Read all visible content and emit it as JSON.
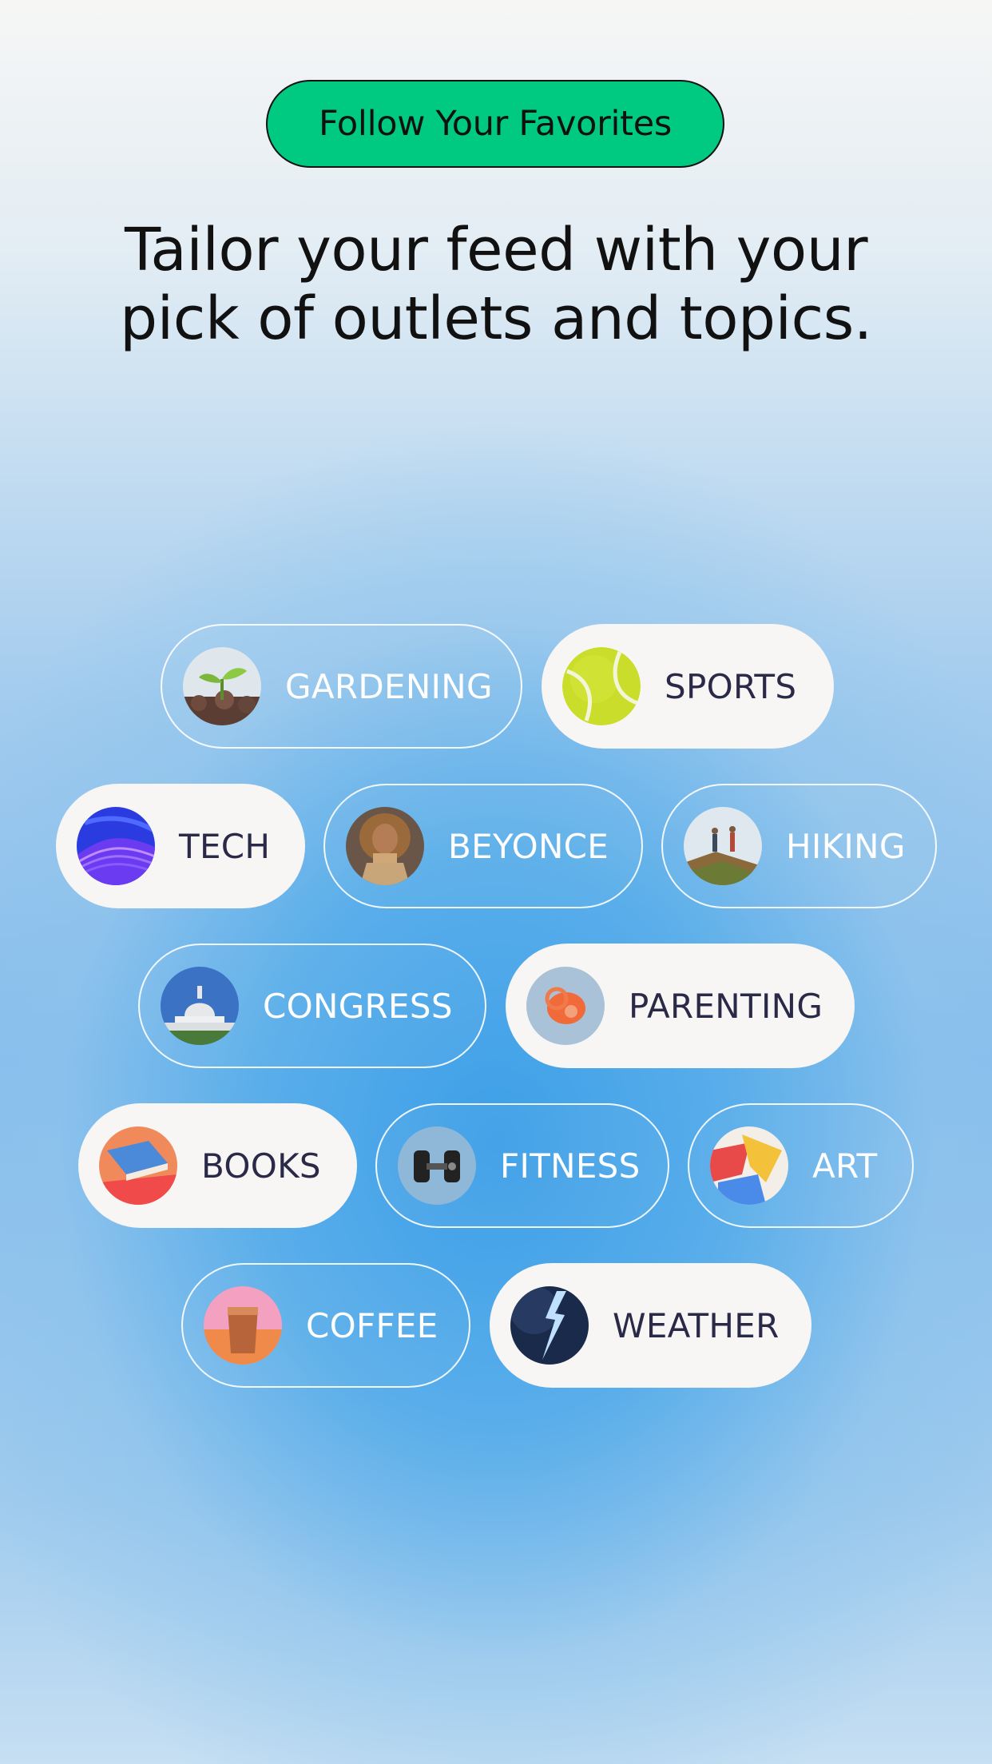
{
  "badge": {
    "label": "Follow Your Favorites"
  },
  "headline": {
    "line1": "Tailor your feed with your",
    "line2": "pick of outlets and topics."
  },
  "topics": [
    {
      "label": "GARDENING",
      "selected": false,
      "icon": "seedling-icon"
    },
    {
      "label": "SPORTS",
      "selected": true,
      "icon": "tennis-ball-icon"
    },
    {
      "label": "TECH",
      "selected": true,
      "icon": "tech-wave-icon"
    },
    {
      "label": "BEYONCE",
      "selected": false,
      "icon": "beyonce-avatar"
    },
    {
      "label": "HIKING",
      "selected": false,
      "icon": "hikers-icon"
    },
    {
      "label": "CONGRESS",
      "selected": false,
      "icon": "capitol-icon"
    },
    {
      "label": "PARENTING",
      "selected": true,
      "icon": "pacifier-icon"
    },
    {
      "label": "BOOKS",
      "selected": true,
      "icon": "book-icon"
    },
    {
      "label": "FITNESS",
      "selected": false,
      "icon": "dumbbell-icon"
    },
    {
      "label": "ART",
      "selected": false,
      "icon": "paint-icon"
    },
    {
      "label": "COFFEE",
      "selected": false,
      "icon": "iced-coffee-icon"
    },
    {
      "label": "WEATHER",
      "selected": true,
      "icon": "lightning-icon"
    }
  ],
  "colors": {
    "accent": "#00ca82",
    "pill_fill": "#f8f6f4",
    "pill_text_dark": "#2a2a48",
    "background_blue": "#3d9fe8"
  }
}
